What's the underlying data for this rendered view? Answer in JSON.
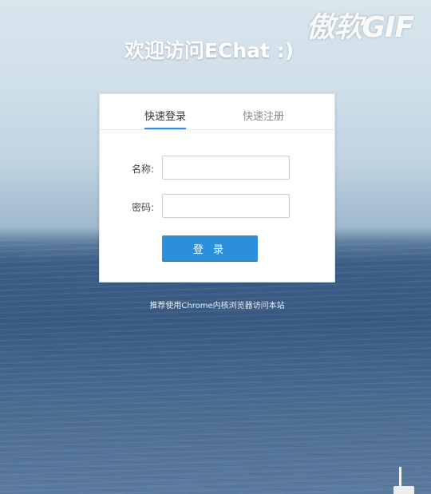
{
  "watermark": "傲软GIF",
  "welcome_title": "欢迎访问EChat :)",
  "tabs": [
    {
      "label": "快速登录",
      "active": true
    },
    {
      "label": "快速注册",
      "active": false
    }
  ],
  "form": {
    "name_label": "名称:",
    "name_value": "",
    "password_label": "密码:",
    "password_value": "",
    "submit_label": "登 录"
  },
  "hint": "推荐使用Chrome内核浏览器访问本站",
  "colors": {
    "accent": "#2b8fdb",
    "tab_underline": "#2d8cf0"
  }
}
